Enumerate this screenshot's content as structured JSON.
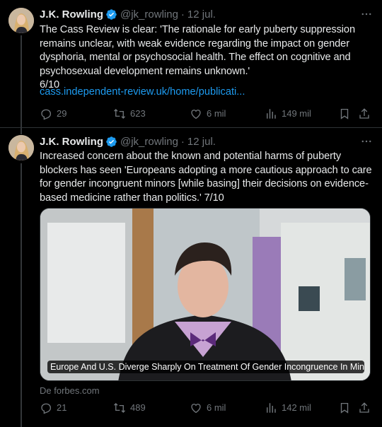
{
  "tweets": [
    {
      "author": "J.K. Rowling",
      "handle": "@jk_rowling",
      "time": "12 jul.",
      "text": "The Cass Review is clear: 'The rationale for early puberty suppression\nremains unclear, with weak evidence regarding the impact on gender\ndysphoria, mental or psychosocial health. The effect on cognitive and\npsychosexual development remains unknown.'\n6/10",
      "link": "cass.independent-review.uk/home/publicati...",
      "actions": {
        "replies": "29",
        "reposts": "623",
        "likes": "6 mil",
        "views": "149 mil"
      }
    },
    {
      "author": "J.K. Rowling",
      "handle": "@jk_rowling",
      "time": "12 jul.",
      "text": "Increased concern about the known and potential harms of puberty\nblockers has seen 'Europeans adopting a more cautious approach to care\nfor gender incongruent minors [while basing] their decisions on evidence-\nbased medicine rather than politics.' 7/10",
      "card": {
        "title": "Europe And U.S. Diverge Sharply On Treatment Of Gender Incongruence In Mino...",
        "source": "De forbes.com"
      },
      "actions": {
        "replies": "21",
        "reposts": "489",
        "likes": "6 mil",
        "views": "142 mil"
      }
    }
  ],
  "colors": {
    "background": "#000000",
    "text": "#e7e9ea",
    "muted": "#71767b",
    "link": "#1d9bf0",
    "verified": "#1d9bf0"
  },
  "icons": [
    "verified-badge-icon",
    "more-icon",
    "reply-icon",
    "repost-icon",
    "like-icon",
    "views-icon",
    "bookmark-icon",
    "share-icon"
  ]
}
